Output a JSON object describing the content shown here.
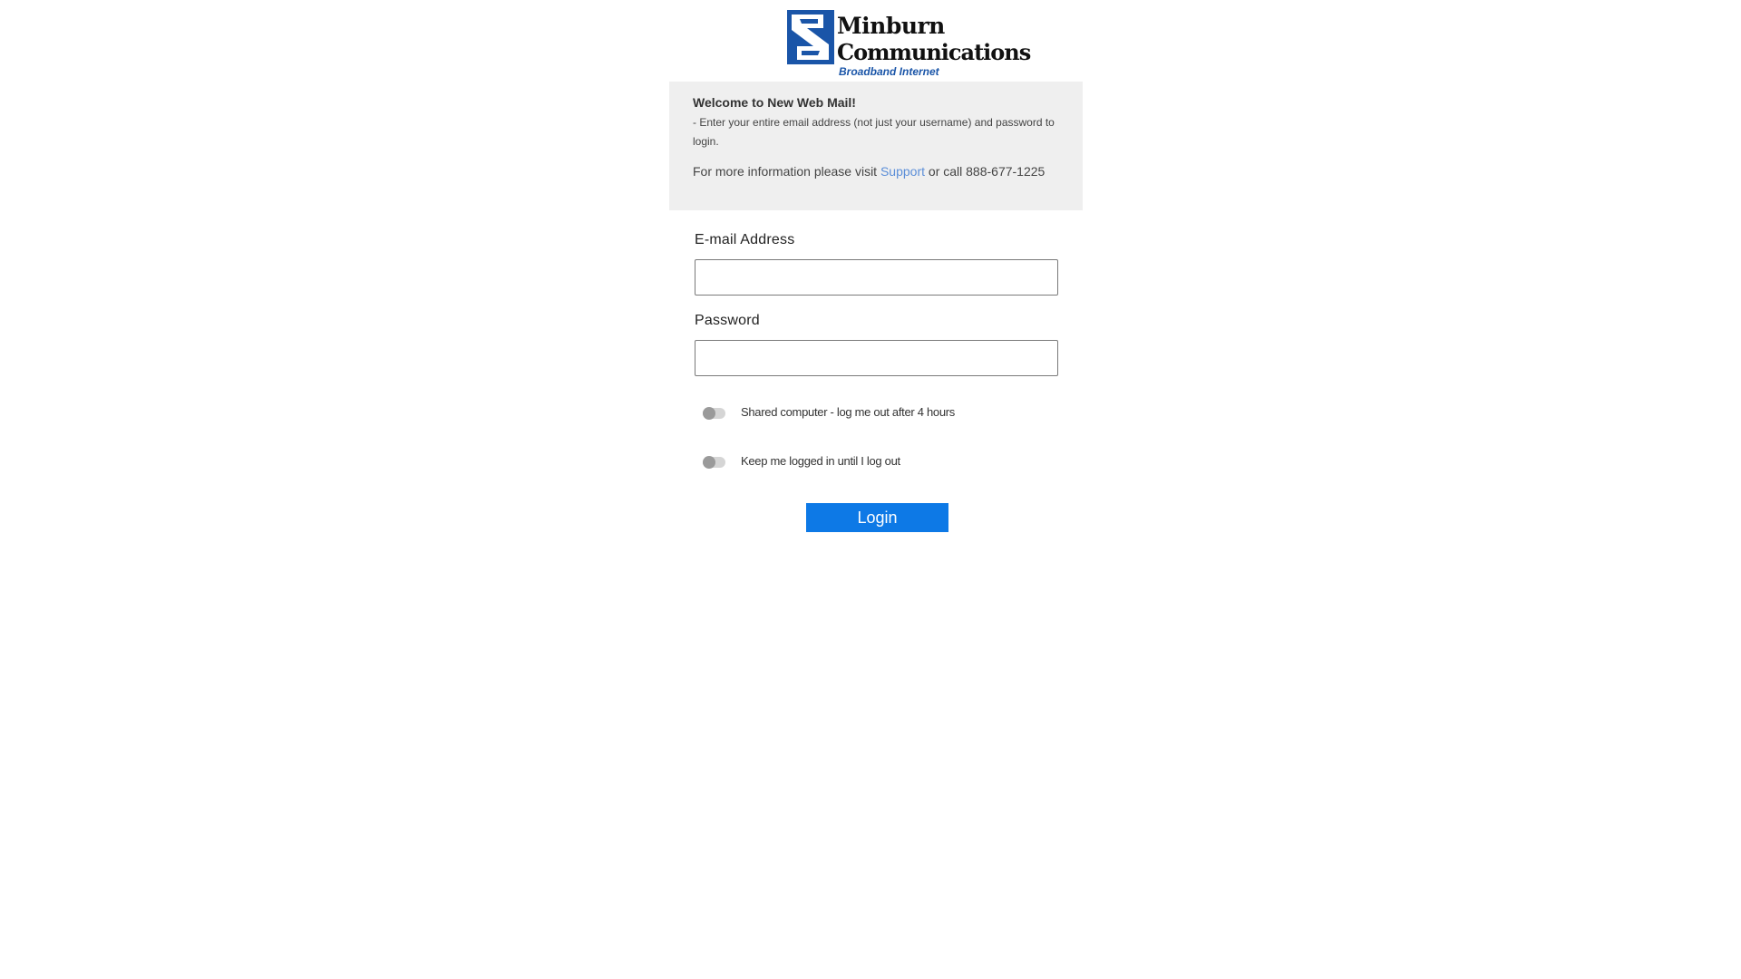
{
  "logo": {
    "name_line1": "Minburn",
    "name_line2": "Communications",
    "tagline": "Broadband Internet",
    "brand_color": "#1a55a8"
  },
  "info": {
    "title": "Welcome to New Web Mail!",
    "instructions": "- Enter your entire email address (not just your username) and password to login.",
    "more_prefix": "For more information please visit ",
    "support_link": "Support",
    "more_suffix": " or call 888-677-1225"
  },
  "form": {
    "email_label": "E-mail Address",
    "email_value": "",
    "password_label": "Password",
    "password_value": "",
    "shared_computer_label": "Shared computer - log me out after 4 hours",
    "shared_computer_on": false,
    "keep_logged_in_label": "Keep me logged in until I log out",
    "keep_logged_in_on": false,
    "login_label": "Login",
    "login_color": "#0d79e6"
  }
}
